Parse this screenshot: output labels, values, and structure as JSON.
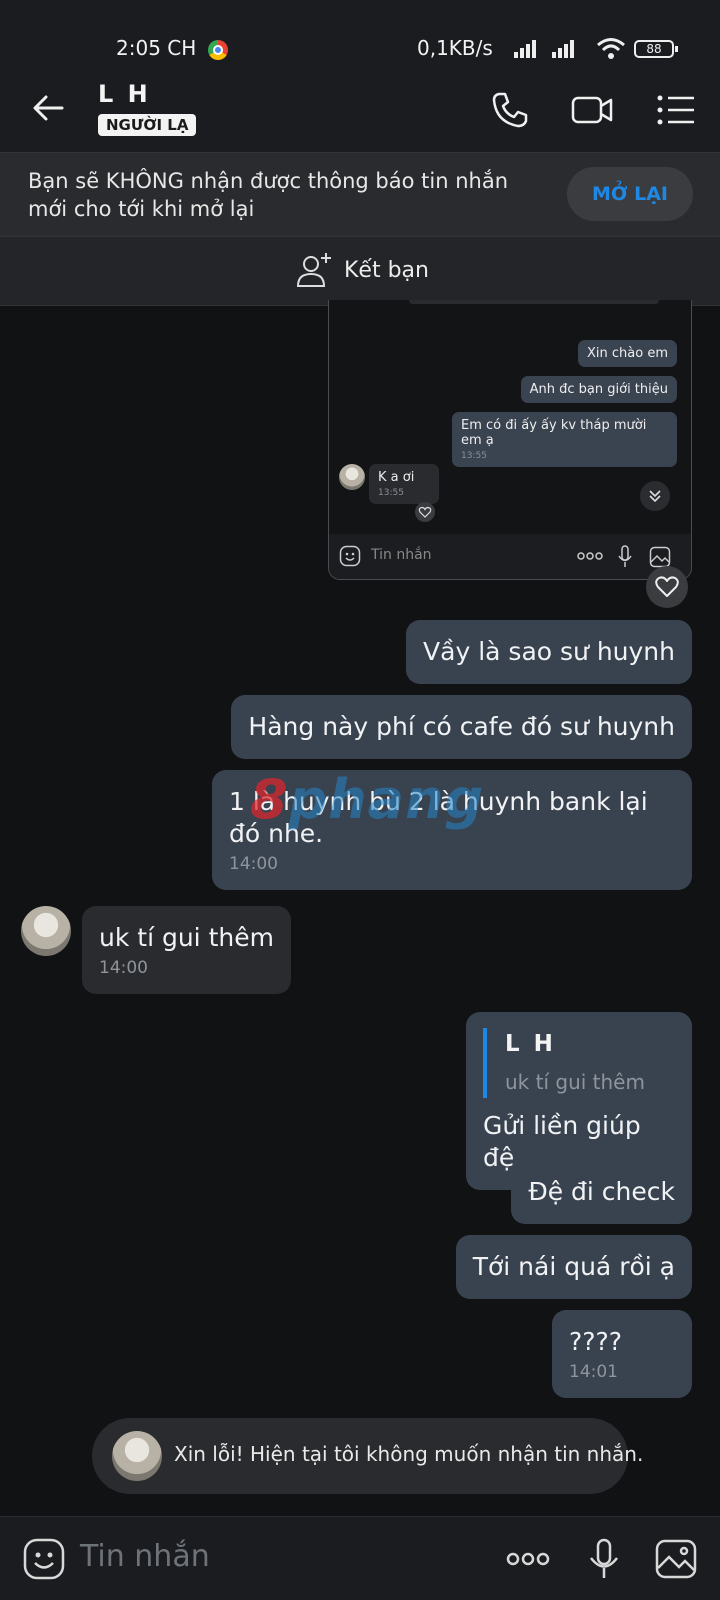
{
  "status_bar": {
    "time": "2:05 CH",
    "network_speed": "0,1KB/s",
    "battery": "88"
  },
  "header": {
    "contact_name": "L H",
    "badge": "NGƯỜI LẠ"
  },
  "notice": {
    "text": "Bạn sẽ KHÔNG nhận được thông báo tin nhắn mới cho tới khi mở lại",
    "button": "MỞ LẠI"
  },
  "add_friend": {
    "label": "Kết bạn"
  },
  "embedded_screenshot": {
    "messages": [
      {
        "text": "Xin chào em"
      },
      {
        "text": "Anh đc bạn giới thiệu"
      },
      {
        "text": "Em có đi ấy ấy kv tháp mười em ạ",
        "time": "13:55"
      },
      {
        "text": "K a ơi",
        "time": "13:55"
      }
    ],
    "input_placeholder": "Tin nhắn"
  },
  "messages": [
    {
      "text": "Vầy là sao sư huynh"
    },
    {
      "text": "Hàng này phí có cafe đó sư huynh"
    },
    {
      "text": "1 là huynh bù 2 là huynh bank lại đó nhe.",
      "time": "14:00"
    },
    {
      "text": "uk tí gui thêm",
      "time": "14:00"
    },
    {
      "quote_name": "L H",
      "quote_text": "uk tí gui thêm",
      "text": "Gửi liền giúp đệ"
    },
    {
      "text": "Đệ đi check"
    },
    {
      "text": "Tới nái quá rồi ạ"
    },
    {
      "text": "????",
      "time": "14:01"
    }
  ],
  "watermark": {
    "first": "8",
    "rest": "phang"
  },
  "system_message": {
    "text": "Xin lỗi! Hiện tại tôi không muốn nhận tin nhắn."
  },
  "composer": {
    "placeholder": "Tin nhắn"
  },
  "colors": {
    "accent": "#1e88e5",
    "outgoing_bubble": "#394350",
    "incoming_bubble": "#2a2b2e",
    "background": "#111214"
  }
}
